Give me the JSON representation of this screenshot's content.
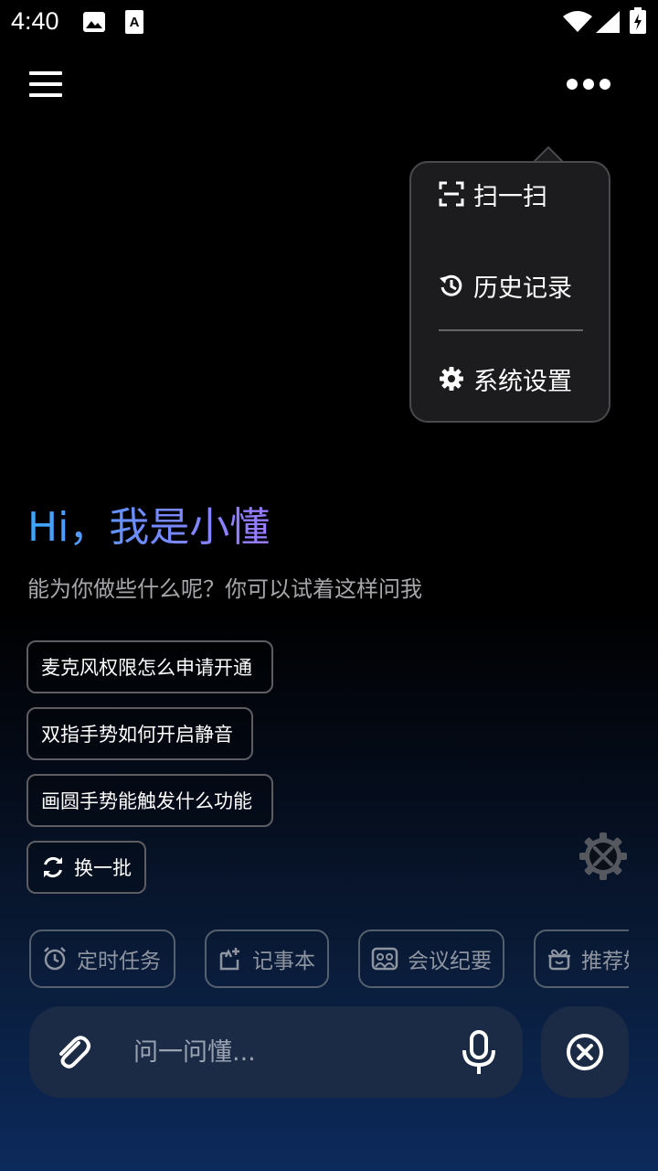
{
  "status_bar": {
    "time": "4:40",
    "left_icons": [
      "image-icon",
      "a-text-icon"
    ],
    "right_icons": [
      "wifi-icon",
      "signal-icon",
      "battery-icon"
    ]
  },
  "top_bar": {
    "left_icon": "menu-icon",
    "right_icon": "more-horizontal-icon"
  },
  "popup_menu": {
    "items": [
      {
        "label": "扫一扫",
        "icon": "scan-icon"
      },
      {
        "label": "历史记录",
        "icon": "history-icon"
      },
      {
        "label": "系统设置",
        "icon": "gear-icon"
      }
    ]
  },
  "hero": {
    "title": "Hi，我是小懂",
    "subtitle": "能为你做些什么呢？你可以试着这样问我"
  },
  "suggestions": [
    "麦克风权限怎么申请开通",
    "双指手势如何开启静音",
    "画圆手势能触发什么功能"
  ],
  "refresh_label": "换一批",
  "quick_actions": [
    {
      "label": "定时任务",
      "icon": "alarm-clock-icon"
    },
    {
      "label": "记事本",
      "icon": "notepad-icon"
    },
    {
      "label": "会议纪要",
      "icon": "meeting-icon"
    },
    {
      "label": "推荐好",
      "icon": "gift-icon"
    }
  ],
  "input": {
    "placeholder": "问一问懂..."
  },
  "colors": {
    "accent_gradient_start": "#3aa7ff",
    "accent_gradient_end": "#9b7bff",
    "input_background": "#1b2a45",
    "popup_background": "#1c1c1e"
  }
}
